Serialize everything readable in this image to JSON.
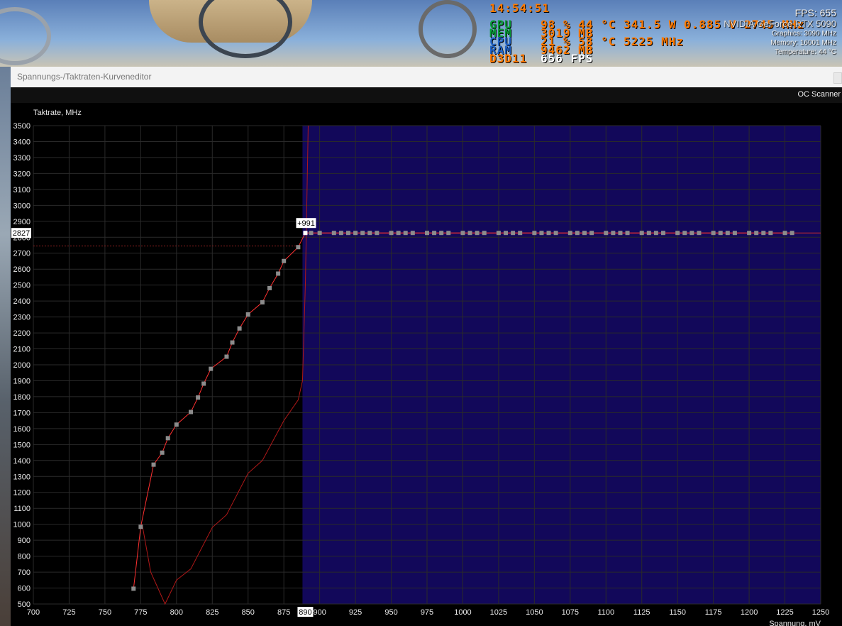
{
  "overlay": {
    "time": "14:54:51",
    "rows": [
      {
        "tag": "GPU",
        "tag_color": "#0b9d3a",
        "text": "98 % 44 °C 341.5 W 0.885 V 2745 MHz"
      },
      {
        "tag": "MEM",
        "tag_color": "#0b9d3a",
        "text": "3019 MB"
      },
      {
        "tag": "CPU",
        "tag_color": "#1f63c7",
        "text": "21 % 58 °C 5225 MHz"
      },
      {
        "tag": "RAM",
        "tag_color": "#1f63c7",
        "text": "9462 MB"
      },
      {
        "tag": "D3D11",
        "tag_color": "#ff7a00",
        "text": "656 FPS",
        "text_color": "#ffffff"
      }
    ],
    "value_color": "#ff7a00"
  },
  "gpu_info": {
    "fps": "FPS: 655",
    "model": "NVIDIA GeForce RTX 5090",
    "graphics": "Graphics: 3090 MHz",
    "memory": "Memory: 16001 MHz",
    "temperature": "Temperature: 44 °C"
  },
  "window": {
    "title": "Spannungs-/Taktraten-Kurveneditor",
    "oc_scanner": "OC Scanner"
  },
  "chart_data": {
    "type": "line",
    "ylabel": "Taktrate, MHz",
    "xlabel": "Spannung, mV",
    "xlim": [
      700,
      1250
    ],
    "ylim": [
      500,
      3500
    ],
    "x_ticks": [
      700,
      725,
      750,
      775,
      800,
      825,
      850,
      875,
      900,
      925,
      950,
      975,
      1000,
      1025,
      1050,
      1075,
      1100,
      1125,
      1150,
      1175,
      1200,
      1225,
      1250
    ],
    "y_ticks": [
      500,
      600,
      700,
      800,
      900,
      1000,
      1100,
      1200,
      1300,
      1400,
      1500,
      1600,
      1700,
      1800,
      1900,
      2000,
      2100,
      2200,
      2300,
      2400,
      2500,
      2600,
      2700,
      2800,
      2900,
      3000,
      3100,
      3200,
      3300,
      3400,
      3500
    ],
    "grid": true,
    "colors": {
      "background": "#000000",
      "locked_region": "#12085a",
      "grid": "#2a2a2a",
      "curve": "#ff3030",
      "default_curve": "#b01818",
      "point": "#8c8c8c",
      "selected_point": "#ffffff",
      "horizontal_line": "#d02a2a",
      "current_line": "#8a1f1f"
    },
    "locked_from_mv": 888,
    "selected_point": {
      "x": 890,
      "y": 2827,
      "x_label": "890",
      "y_label": "2827",
      "offset_label": "+991"
    },
    "current_clock": 2745,
    "series": [
      {
        "name": "",
        "x": [
          770,
          775,
          784,
          790,
          794,
          800,
          810,
          815,
          819,
          824,
          835,
          839,
          844,
          850,
          860,
          865,
          871,
          875,
          885,
          890,
          894,
          900,
          910,
          915,
          920,
          925,
          930,
          935,
          940,
          950,
          955,
          960,
          965,
          975,
          980,
          985,
          990,
          1000,
          1005,
          1010,
          1015,
          1025,
          1030,
          1035,
          1040,
          1050,
          1055,
          1060,
          1065,
          1075,
          1080,
          1085,
          1090,
          1100,
          1105,
          1110,
          1115,
          1125,
          1130,
          1135,
          1140,
          1150,
          1155,
          1160,
          1165,
          1175,
          1180,
          1185,
          1190,
          1200,
          1205,
          1210,
          1215,
          1225,
          1230
        ],
        "y": [
          596,
          984,
          1374,
          1449,
          1540,
          1625,
          1704,
          1795,
          1882,
          1975,
          2051,
          2140,
          2228,
          2316,
          2392,
          2481,
          2572,
          2651,
          2738,
          2827,
          2827,
          2827,
          2827,
          2827,
          2827,
          2827,
          2827,
          2827,
          2827,
          2827,
          2827,
          2827,
          2827,
          2827,
          2827,
          2827,
          2827,
          2827,
          2827,
          2827,
          2827,
          2827,
          2827,
          2827,
          2827,
          2827,
          2827,
          2827,
          2827,
          2827,
          2827,
          2827,
          2827,
          2827,
          2827,
          2827,
          2827,
          2827,
          2827,
          2827,
          2827,
          2827,
          2827,
          2827,
          2827,
          2827,
          2827,
          2827,
          2827,
          2827,
          2827,
          2827,
          2827,
          2827,
          2827
        ]
      },
      {
        "name": "",
        "x": [
          776,
          782,
          792,
          800,
          810,
          825,
          835,
          850,
          860,
          875,
          885,
          888,
          890,
          891,
          892
        ],
        "y": [
          1000,
          700,
          500,
          650,
          720,
          980,
          1060,
          1320,
          1400,
          1650,
          1780,
          1900,
          2500,
          3000,
          3500
        ]
      }
    ]
  }
}
